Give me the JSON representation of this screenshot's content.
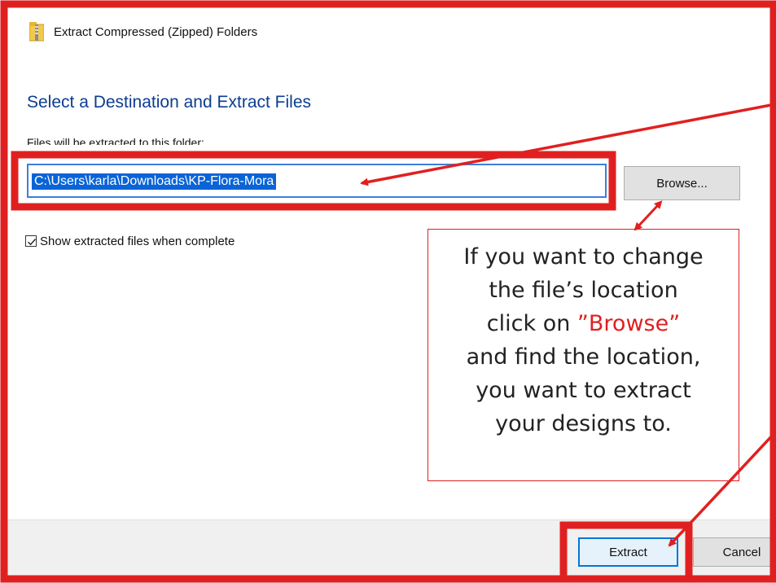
{
  "window": {
    "title": "Extract Compressed (Zipped) Folders"
  },
  "heading": "Select a Destination and Extract Files",
  "destination": {
    "label": "Files will be extracted to this folder:",
    "value": "C:\\Users\\karla\\Downloads\\KP-Flora-Mora"
  },
  "browse_button": "Browse...",
  "show_files_checkbox": {
    "label": "Show extracted files when complete",
    "checked": true
  },
  "buttons": {
    "extract": "Extract",
    "cancel": "Cancel"
  },
  "callout": {
    "line1": "If you want to change",
    "line2": "the file’s location",
    "line3_prefix": "click on ",
    "line3_highlight": "”Browse”",
    "line4": "and find the location,",
    "line5": "you want to extract",
    "line6": "your designs to."
  },
  "colors": {
    "annotation": "#e02020",
    "heading": "#0b3d91",
    "selection": "#0a64d6",
    "focus": "#0078d7"
  },
  "icons": {
    "title": "zip-folder-icon",
    "checkbox": "checkmark-icon"
  }
}
